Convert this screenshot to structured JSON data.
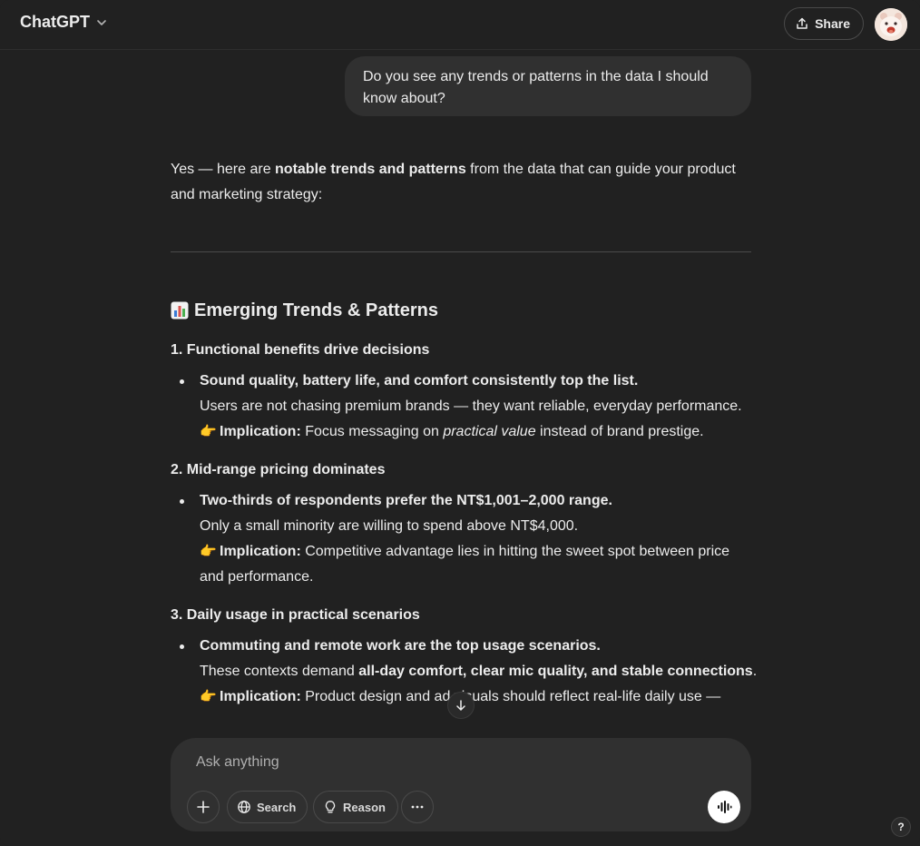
{
  "header": {
    "title": "ChatGPT",
    "share_label": "Share"
  },
  "user_message": "Do you see any trends or patterns in the data I should know about?",
  "response": {
    "intro_prefix": "Yes — here are ",
    "intro_bold": "notable trends and patterns",
    "intro_suffix": " from the data that can guide your product and marketing strategy:",
    "heading": "Emerging Trends & Patterns",
    "sections": [
      {
        "title": "1. Functional benefits drive decisions",
        "bullet_bold": "Sound quality, battery life, and comfort consistently top the list.",
        "detail": "Users are not chasing premium brands — they want reliable, everyday performance.",
        "implication_label": "Implication:",
        "implication_prefix": " Focus messaging on ",
        "implication_italic": "practical value",
        "implication_suffix": " instead of brand prestige."
      },
      {
        "title": "2. Mid-range pricing dominates",
        "bullet_bold": "Two-thirds of respondents prefer the NT$1,001–2,000 range.",
        "detail": "Only a small minority are willing to spend above NT$4,000.",
        "implication_label": "Implication:",
        "implication_text": " Competitive advantage lies in hitting the sweet spot between price and performance."
      },
      {
        "title": "3. Daily usage in practical scenarios",
        "bullet_bold": "Commuting and remote work are the top usage scenarios.",
        "detail_prefix": "These contexts demand ",
        "detail_bold": "all-day comfort, clear mic quality, and stable connections",
        "detail_suffix": ".",
        "implication_label": "Implication:",
        "implication_text": " Product design and ad visuals should reflect real-life daily use —"
      }
    ]
  },
  "composer": {
    "placeholder": "Ask anything",
    "search_label": "Search",
    "reason_label": "Reason"
  },
  "help_label": "?",
  "icons": {
    "chart": "bar-chart-emoji",
    "pointing": "pointing-hand-emoji"
  }
}
